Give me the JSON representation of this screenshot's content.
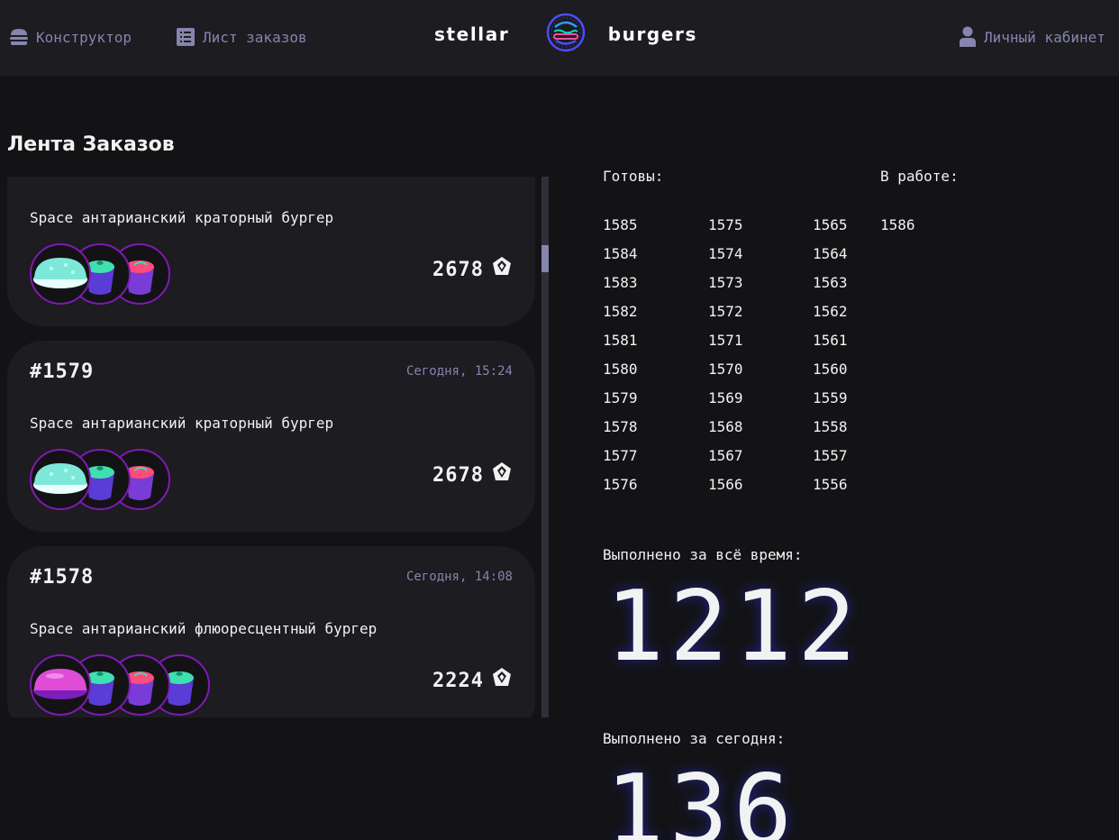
{
  "nav": {
    "constructor_label": "Конструктор",
    "feed_label": "Лист заказов",
    "profile_label": "Личный кабинет",
    "logo_left": "stellar",
    "logo_right": "burgers",
    "icons": [
      "burger-icon",
      "list-icon",
      "profile-icon"
    ]
  },
  "page": {
    "title": "Лента Заказов"
  },
  "orders": [
    {
      "number": "",
      "date": "",
      "name": "Space антарианский краторный бургер",
      "price": "2678",
      "ingredients": [
        "bun-cyan",
        "sauce-green",
        "sauce-red"
      ]
    },
    {
      "number": "#1579",
      "date": "Сегодня, 15:24",
      "name": "Space антарианский краторный бургер",
      "price": "2678",
      "ingredients": [
        "bun-cyan",
        "sauce-green",
        "sauce-red"
      ]
    },
    {
      "number": "#1578",
      "date": "Сегодня, 14:08",
      "name": "Space антарианский флюоресцентный бургер",
      "price": "2224",
      "ingredients": [
        "bun-pink",
        "sauce-green",
        "sauce-red",
        "sauce-green"
      ]
    }
  ],
  "board": {
    "ready_label": "Готовы:",
    "in_work_label": "В работе:",
    "ready_col1": [
      "1585",
      "1584",
      "1583",
      "1582",
      "1581",
      "1580",
      "1579",
      "1578",
      "1577",
      "1576"
    ],
    "ready_col2": [
      "1575",
      "1574",
      "1573",
      "1572",
      "1571",
      "1570",
      "1569",
      "1568",
      "1567",
      "1566"
    ],
    "ready_col3": [
      "1565",
      "1564",
      "1563",
      "1562",
      "1561",
      "1560",
      "1559",
      "1558",
      "1557",
      "1556"
    ],
    "in_work": [
      "1586"
    ]
  },
  "stats": {
    "total_label": "Выполнено за всё время:",
    "total_value": "1212",
    "today_label": "Выполнено за сегодня:",
    "today_value": "136"
  },
  "colors": {
    "background": "#131316",
    "panel": "#1c1c21",
    "muted_text": "#8585ad",
    "ingredient_border": "#801ab2",
    "ready_text": "#f2f2f3"
  }
}
